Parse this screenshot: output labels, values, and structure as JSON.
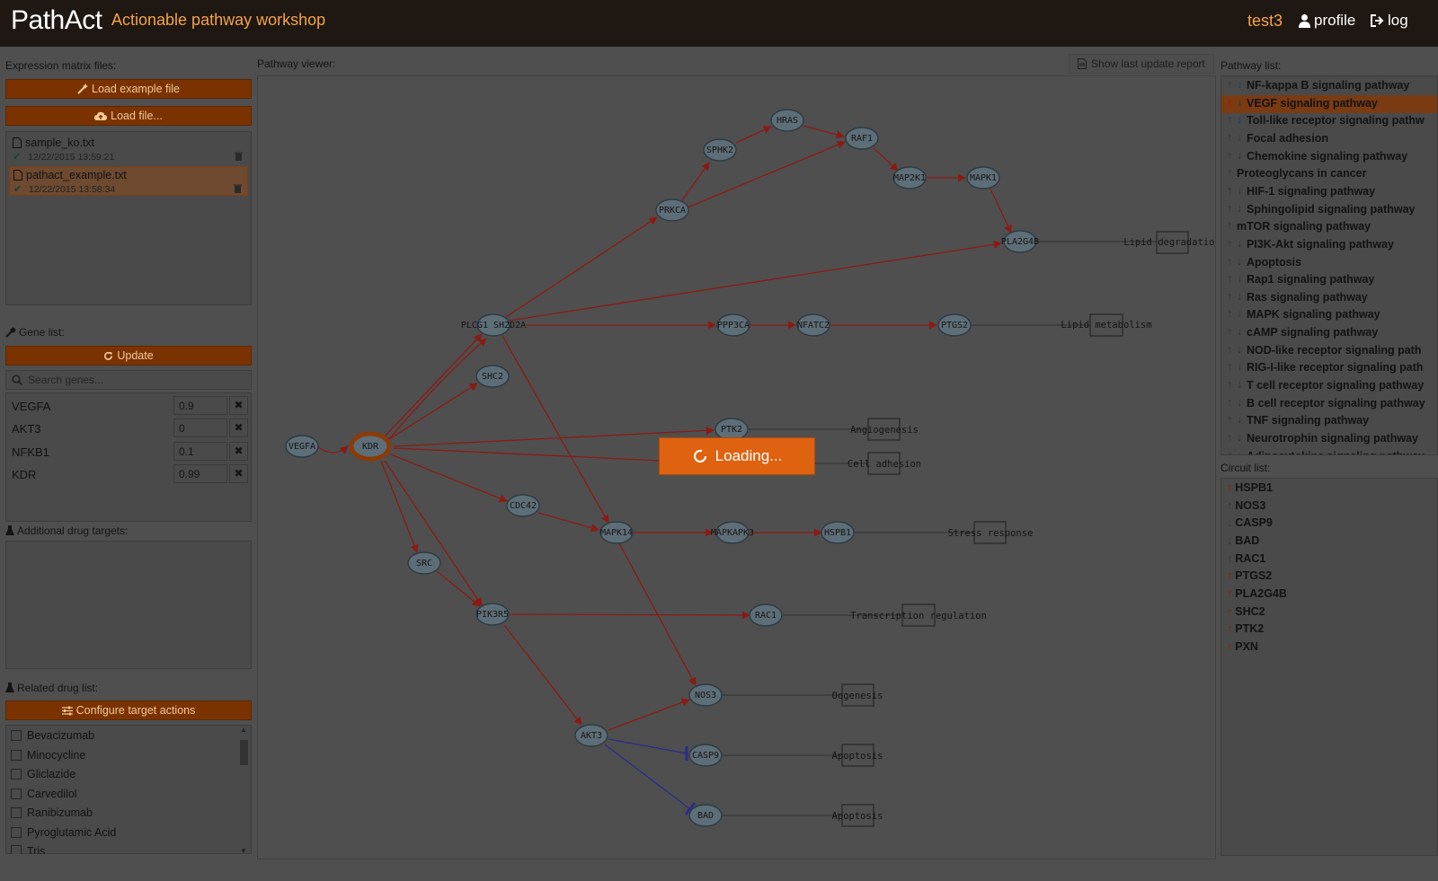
{
  "header": {
    "logo": "PathAct",
    "subtitle": "Actionable pathway workshop",
    "user": "test3",
    "profile_label": "profile",
    "logout_label": "log"
  },
  "expression": {
    "label": "Expression matrix files:",
    "load_example": "Load example file",
    "load_file": "Load file...",
    "files": [
      {
        "name": "sample_ko.txt",
        "date": "12/22/2015 13:59:21"
      },
      {
        "name": "pathact_example.txt",
        "date": "12/22/2015 13:58:34"
      }
    ]
  },
  "gene_list": {
    "label": "Gene list:",
    "update": "Update",
    "search_placeholder": "Search genes...",
    "genes": [
      {
        "name": "VEGFA",
        "value": "0.9"
      },
      {
        "name": "AKT3",
        "value": "0"
      },
      {
        "name": "NFKB1",
        "value": "0.1"
      },
      {
        "name": "KDR",
        "value": "0.99"
      }
    ]
  },
  "additional": {
    "label": "Additional drug targets:"
  },
  "drugs": {
    "label": "Related drug list:",
    "configure": "Configure target actions",
    "items": [
      "Bevacizumab",
      "Minocycline",
      "Gliclazide",
      "Carvedilol",
      "Ranibizumab",
      "Pyroglutamic Acid",
      "Tris"
    ]
  },
  "viewer": {
    "label": "Pathway viewer:",
    "report_button": "Show last update report",
    "loading": "Loading...",
    "nodes": [
      {
        "id": "VEGFA",
        "label": "VEGFA"
      },
      {
        "id": "KDR",
        "label": "KDR"
      },
      {
        "id": "PLCG1",
        "label": "PLCG1 SH2D2A"
      },
      {
        "id": "SHC2",
        "label": "SHC2"
      },
      {
        "id": "PRKCA",
        "label": "PRKCA"
      },
      {
        "id": "SPHK2",
        "label": "SPHK2"
      },
      {
        "id": "HRAS",
        "label": "HRAS"
      },
      {
        "id": "RAF1",
        "label": "RAF1"
      },
      {
        "id": "MAP2K1",
        "label": "MAP2K1"
      },
      {
        "id": "MAPK1",
        "label": "MAPK1"
      },
      {
        "id": "PLA2G4B",
        "label": "PLA2G4B"
      },
      {
        "id": "PPP3CA",
        "label": "PPP3CA"
      },
      {
        "id": "NFATC2",
        "label": "NFATC2"
      },
      {
        "id": "PTGS2",
        "label": "PTGS2"
      },
      {
        "id": "PTK2",
        "label": "PTK2"
      },
      {
        "id": "CDC42",
        "label": "CDC42"
      },
      {
        "id": "MAPK14",
        "label": "MAPK14"
      },
      {
        "id": "MAPKAPK3",
        "label": "MAPKAPK3"
      },
      {
        "id": "HSPB1",
        "label": "HSPB1"
      },
      {
        "id": "SRC",
        "label": "SRC"
      },
      {
        "id": "PIK3R5",
        "label": "PIK3R5"
      },
      {
        "id": "RAC1",
        "label": "RAC1"
      },
      {
        "id": "NOS3",
        "label": "NOS3"
      },
      {
        "id": "AKT3",
        "label": "AKT3"
      },
      {
        "id": "CASP9",
        "label": "CASP9"
      },
      {
        "id": "BAD",
        "label": "BAD"
      }
    ],
    "functions": [
      {
        "id": "lipid_degradation",
        "label": "Lipid degradation"
      },
      {
        "id": "lipid_metabolism",
        "label": "Lipid metabolism"
      },
      {
        "id": "angiogenesis",
        "label": "Angiogenesis"
      },
      {
        "id": "cell_adhesion",
        "label": "Cell adhesion"
      },
      {
        "id": "stress_response",
        "label": "Stress response"
      },
      {
        "id": "transcription_regulation",
        "label": "Transcription regulation"
      },
      {
        "id": "oogenesis",
        "label": "Oogenesis"
      },
      {
        "id": "apoptosis_casp9",
        "label": "Apoptosis"
      },
      {
        "id": "apoptosis_bad",
        "label": "Apoptosis"
      }
    ]
  },
  "pathways": {
    "label": "Pathway list:",
    "items": [
      {
        "name": "NF-kappa B signaling pathway",
        "up": "grey",
        "down": "blue"
      },
      {
        "name": "VEGF signaling pathway",
        "up": "red",
        "down": "grey",
        "selected": true
      },
      {
        "name": "Toll-like receptor signaling pathw",
        "up": "grey",
        "down": "blue"
      },
      {
        "name": "Focal adhesion",
        "up": "grey",
        "down": "grey"
      },
      {
        "name": "Chemokine signaling pathway",
        "up": "grey",
        "down": "grey"
      },
      {
        "name": "Proteoglycans in cancer",
        "up": "grey"
      },
      {
        "name": "HIF-1 signaling pathway",
        "up": "grey",
        "down": "grey"
      },
      {
        "name": "Sphingolipid signaling pathway",
        "up": "grey",
        "down": "grey"
      },
      {
        "name": "mTOR signaling pathway",
        "up": "grey"
      },
      {
        "name": "PI3K-Akt signaling pathway",
        "up": "grey",
        "down": "grey"
      },
      {
        "name": "Apoptosis",
        "up": "grey",
        "down": "grey"
      },
      {
        "name": "Rap1 signaling pathway",
        "up": "grey",
        "down": "grey"
      },
      {
        "name": "Ras signaling pathway",
        "up": "grey",
        "down": "grey"
      },
      {
        "name": "MAPK signaling pathway",
        "up": "grey",
        "down": "grey"
      },
      {
        "name": "cAMP signaling pathway",
        "up": "grey",
        "down": "grey"
      },
      {
        "name": "NOD-like receptor signaling path",
        "up": "grey",
        "down": "grey"
      },
      {
        "name": "RIG-I-like receptor signaling path",
        "up": "grey",
        "down": "grey"
      },
      {
        "name": "T cell receptor signaling pathway",
        "up": "grey",
        "down": "grey"
      },
      {
        "name": "B cell receptor signaling pathway",
        "up": "grey",
        "down": "grey"
      },
      {
        "name": "TNF signaling pathway",
        "up": "grey",
        "down": "grey"
      },
      {
        "name": "Neurotrophin signaling pathway",
        "up": "grey",
        "down": "grey"
      },
      {
        "name": "Adipocytokine signaling pathway",
        "up": "grey",
        "down": "grey"
      }
    ]
  },
  "circuits": {
    "label": "Circuit list:",
    "items": [
      {
        "name": "HSPB1",
        "dir": "up-red"
      },
      {
        "name": "NOS3",
        "dir": "up-grey"
      },
      {
        "name": "CASP9",
        "dir": "down-grey"
      },
      {
        "name": "BAD",
        "dir": "down-grey"
      },
      {
        "name": "RAC1",
        "dir": "up-grey"
      },
      {
        "name": "PTGS2",
        "dir": "up-red"
      },
      {
        "name": "PLA2G4B",
        "dir": "up-red"
      },
      {
        "name": "SHC2",
        "dir": "up-red"
      },
      {
        "name": "PTK2",
        "dir": "up-red"
      },
      {
        "name": "PXN",
        "dir": "up-red"
      }
    ]
  },
  "colors": {
    "header_bg": "#1e1712",
    "accent": "#de6210",
    "button": "#7a3300",
    "selected": "#7a3b12",
    "up": "#9b1a10",
    "down": "#193a78"
  }
}
